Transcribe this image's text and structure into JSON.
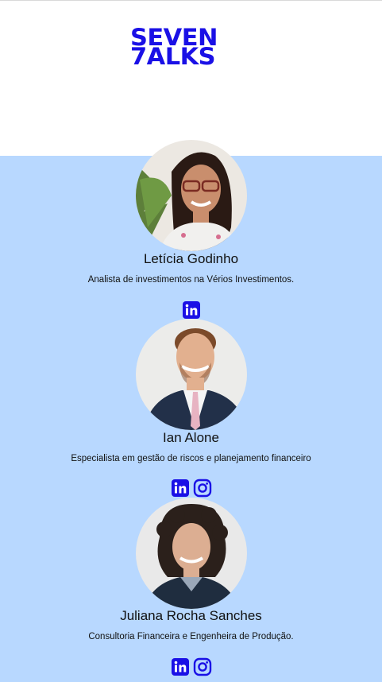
{
  "brand": {
    "line1": "SEVEN",
    "line2": "7ALKS",
    "color": "#1a10e6"
  },
  "colors": {
    "section_bg": "#b8d8ff",
    "icon": "#1a10e6"
  },
  "people": [
    {
      "name": "Letícia Godinho",
      "role": "Analista de investimentos na Vérios Investimentos.",
      "socials": [
        "linkedin-icon"
      ]
    },
    {
      "name": "Ian Alone",
      "role": "Especialista em gestão de riscos e planejamento financeiro",
      "socials": [
        "linkedin-icon",
        "instagram-icon"
      ]
    },
    {
      "name": "Juliana Rocha Sanches",
      "role": "Consultoria Financeira e Engenheira de Produção.",
      "socials": [
        "linkedin-icon",
        "instagram-icon"
      ]
    }
  ]
}
